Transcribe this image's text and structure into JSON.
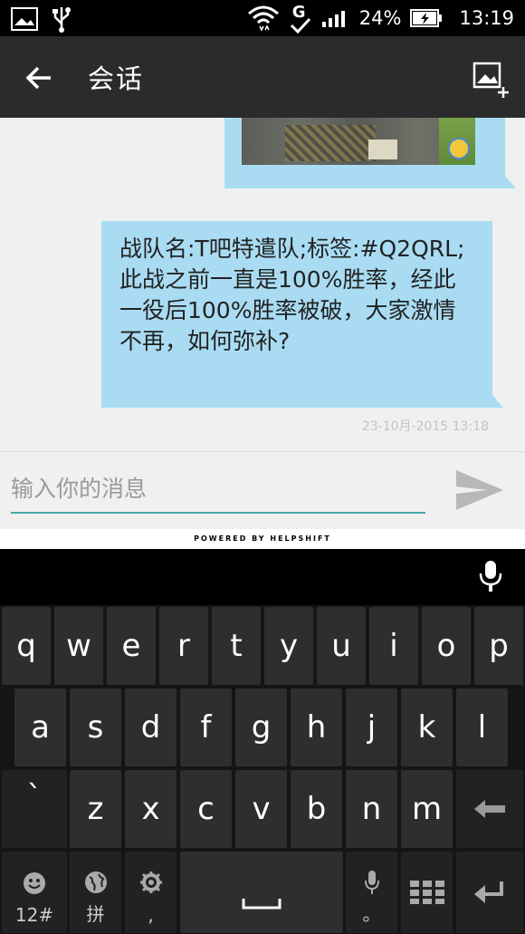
{
  "status_bar": {
    "battery": "24%",
    "time": "13:19",
    "network_letter": "G"
  },
  "header": {
    "title": "会话"
  },
  "conversation": {
    "message": "战队名:T吧特遣队;标签:#Q2QRL;此战之前一直是100%胜率，经此一役后100%胜率被破，大家激情不再，如何弥补?",
    "timestamp": "23-10月-2015 13:18"
  },
  "input": {
    "placeholder": "输入你的消息"
  },
  "branding": {
    "powered_by": "POWERED BY HELPSHIFT"
  },
  "keyboard": {
    "row1": [
      "q",
      "w",
      "e",
      "r",
      "t",
      "y",
      "u",
      "i",
      "o",
      "p"
    ],
    "row2": [
      "a",
      "s",
      "d",
      "f",
      "g",
      "h",
      "j",
      "k",
      "l"
    ],
    "row3": [
      "`",
      "z",
      "x",
      "c",
      "v",
      "b",
      "n",
      "m"
    ],
    "emoji_sub": "12#",
    "lang_sub": "拼",
    "settings_sub": ",",
    "mic_sub": "。"
  },
  "colors": {
    "bubble": "#a9dcf3",
    "accent": "#4aa7a5",
    "appbar": "#2b2b2b"
  }
}
